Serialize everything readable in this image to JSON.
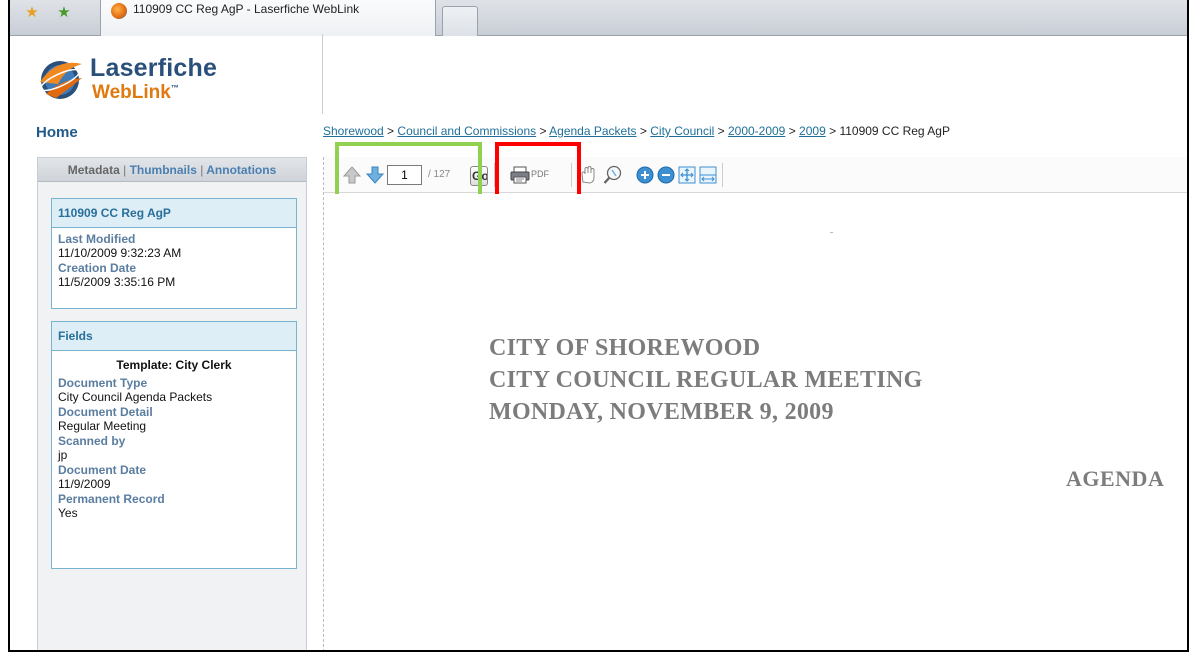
{
  "browser": {
    "tab_title": "110909 CC Reg AgP - Laserfiche WebLink"
  },
  "logo": {
    "brand": "Laserfiche",
    "product": "WebLink",
    "tm": "™"
  },
  "nav": {
    "home": "Home"
  },
  "breadcrumb": {
    "items": [
      "Shorewood",
      "Council and Commissions",
      "Agenda Packets",
      "City Council",
      "2000-2009",
      "2009"
    ],
    "separator": " > ",
    "current": "110909 CC Reg AgP"
  },
  "panel_tabs": {
    "metadata": "Metadata",
    "thumbnails": "Thumbnails",
    "annotations": "Annotations",
    "sep": "|"
  },
  "metadata_box": {
    "title": "110909 CC Reg AgP",
    "last_modified_label": "Last Modified",
    "last_modified_value": "11/10/2009 9:32:23 AM",
    "creation_date_label": "Creation Date",
    "creation_date_value": "11/5/2009 3:35:16 PM"
  },
  "fields_box": {
    "title": "Fields",
    "template": "Template: City Clerk",
    "fields": [
      {
        "label": "Document Type",
        "value": "City Council Agenda Packets"
      },
      {
        "label": "Document Detail",
        "value": "Regular Meeting"
      },
      {
        "label": "Scanned by",
        "value": "jp"
      },
      {
        "label": "Document Date",
        "value": "11/9/2009"
      },
      {
        "label": "Permanent Record",
        "value": "Yes"
      }
    ]
  },
  "toolbar": {
    "page_value": "1",
    "page_total": "/ 127",
    "go_label": "Go",
    "pdf_label": "PDF"
  },
  "document": {
    "line1": "CITY OF SHOREWOOD",
    "line2": "CITY COUNCIL REGULAR MEETING",
    "line3": "MONDAY, NOVEMBER 9, 2009",
    "agenda": "AGENDA"
  },
  "colors": {
    "highlight_green": "#92d050",
    "highlight_red": "#ff0000",
    "link_blue": "#1f6f9a",
    "brand_orange": "#e07a10",
    "brand_navy": "#2a4f7a"
  }
}
